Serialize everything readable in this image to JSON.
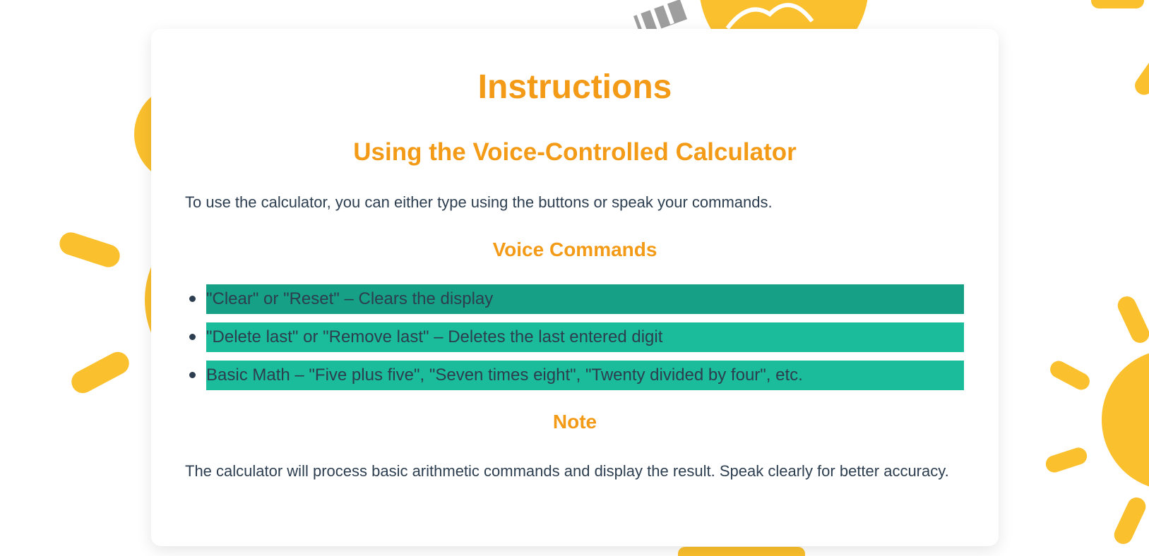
{
  "page": {
    "title": "Instructions",
    "subtitle": "Using the Voice-Controlled Calculator",
    "intro": "To use the calculator, you can either type using the buttons or speak your commands."
  },
  "voice_commands": {
    "heading": "Voice Commands",
    "items": [
      {
        "text": "\"Clear\" or \"Reset\" – Clears the display",
        "state": "active"
      },
      {
        "text": "\"Delete last\" or \"Remove last\" – Deletes the last entered digit",
        "state": "normal"
      },
      {
        "text": "Basic Math – \"Five plus five\", \"Seven times eight\", \"Twenty divided by four\", etc.",
        "state": "normal"
      }
    ]
  },
  "note": {
    "heading": "Note",
    "text": "The calculator will process basic arithmetic commands and display the result. Speak clearly for better accuracy."
  },
  "colors": {
    "heading": "#f39a16",
    "body_text": "#2c3e50",
    "command_bg": "#1abc9c",
    "command_bg_active": "#16a085",
    "decor": "#fbc02d"
  },
  "icons": {
    "background": "lightbulb-sun-pattern"
  }
}
